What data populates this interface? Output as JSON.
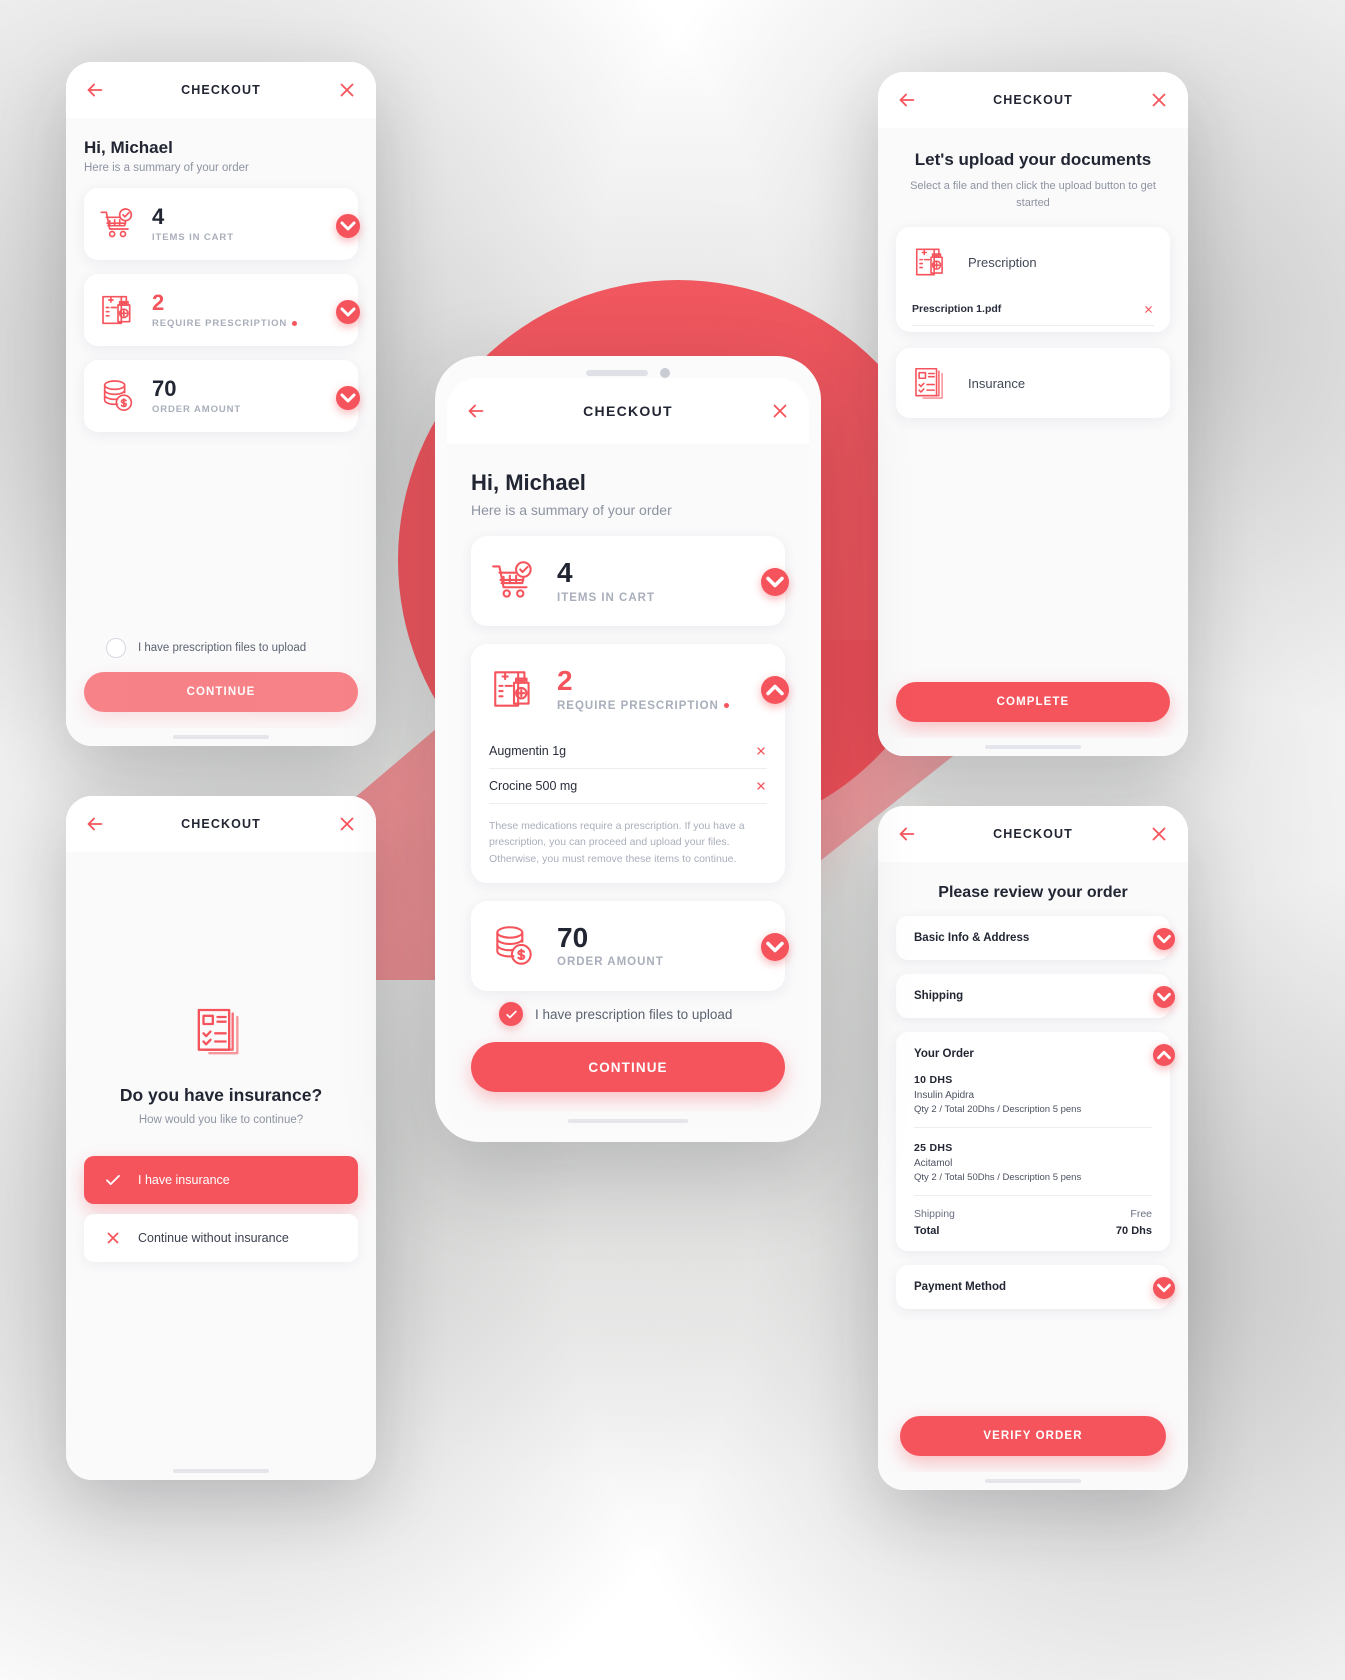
{
  "brand": {
    "accent": "#f5545c",
    "dark": "#222633",
    "muted": "#8e93a1"
  },
  "screens": {
    "summary_collapsed": {
      "topbar": {
        "title": "CHECKOUT",
        "back_icon": "arrow-left-icon",
        "close_icon": "close-icon"
      },
      "greeting": "Hi, Michael",
      "greeting_sub": "Here is a summary of your order",
      "cards": [
        {
          "value": "4",
          "label": "ITEMS IN CART",
          "icon": "shopping-cart-check-icon",
          "dot": false
        },
        {
          "value": "2",
          "label": "REQUIRE PRESCRIPTION",
          "icon": "prescription-icon",
          "dot": true
        },
        {
          "value": "70",
          "label": "ORDER AMOUNT",
          "icon": "coins-dollar-icon",
          "dot": false
        }
      ],
      "checkbox_label": "I have prescription files to upload",
      "checkbox_checked": false,
      "cta": "CONTINUE"
    },
    "summary_expanded": {
      "topbar": {
        "title": "CHECKOUT",
        "back_icon": "arrow-left-icon",
        "close_icon": "close-icon"
      },
      "greeting": "Hi, Michael",
      "greeting_sub": "Here is a summary of your order",
      "card_cart": {
        "value": "4",
        "label": "ITEMS IN CART",
        "icon": "shopping-cart-check-icon"
      },
      "card_rx": {
        "value": "2",
        "label": "REQUIRE PRESCRIPTION",
        "icon": "prescription-icon",
        "items": [
          {
            "name": "Augmentin 1g",
            "remove_icon": "close-icon"
          },
          {
            "name": "Crocine 500 mg",
            "remove_icon": "close-icon"
          }
        ],
        "note": "These medications require a prescription. If you have a prescription, you can proceed and upload your files. Otherwise, you must remove these items to continue."
      },
      "card_amount": {
        "value": "70",
        "label": "ORDER AMOUNT",
        "icon": "coins-dollar-icon"
      },
      "checkbox_label": "I have prescription files to upload",
      "checkbox_checked": true,
      "cta": "CONTINUE"
    },
    "insurance": {
      "topbar": {
        "title": "CHECKOUT",
        "back_icon": "arrow-left-icon",
        "close_icon": "close-icon"
      },
      "hero_icon": "insurance-documents-icon",
      "title": "Do you have insurance?",
      "subtitle": "How would you like to continue?",
      "options": [
        {
          "label": "I have insurance",
          "icon": "check-icon",
          "selected": true
        },
        {
          "label": "Continue without insurance",
          "icon": "close-icon",
          "selected": false
        }
      ]
    },
    "upload": {
      "topbar": {
        "title": "CHECKOUT",
        "back_icon": "arrow-left-icon",
        "close_icon": "close-icon"
      },
      "title": "Let's upload your documents",
      "subtitle": "Select a file and then click the upload button to get started",
      "docs": [
        {
          "label": "Prescription",
          "icon": "prescription-icon",
          "file": "Prescription 1.pdf",
          "remove_icon": "close-icon"
        },
        {
          "label": "Insurance",
          "icon": "insurance-documents-icon",
          "file": null,
          "remove_icon": null
        }
      ],
      "cta": "COMPLETE"
    },
    "review": {
      "topbar": {
        "title": "CHECKOUT",
        "back_icon": "arrow-left-icon",
        "close_icon": "close-icon"
      },
      "title": "Please review your order",
      "sections": [
        {
          "title": "Basic Info & Address",
          "open": false
        },
        {
          "title": "Shipping",
          "open": false
        },
        {
          "title": "Your Order",
          "open": true
        },
        {
          "title": "Payment Method",
          "open": false
        }
      ],
      "order_items": [
        {
          "price": "10 DHS",
          "name": "Insulin Apidra",
          "meta": "Qty 2 / Total 20Dhs / Description 5 pens"
        },
        {
          "price": "25 DHS",
          "name": "Acitamol",
          "meta": "Qty 2 / Total 50Dhs / Description 5 pens"
        }
      ],
      "shipping_label": "Shipping",
      "shipping_value": "Free",
      "total_label": "Total",
      "total_value": "70 Dhs",
      "cta": "VERIFY ORDER"
    }
  }
}
